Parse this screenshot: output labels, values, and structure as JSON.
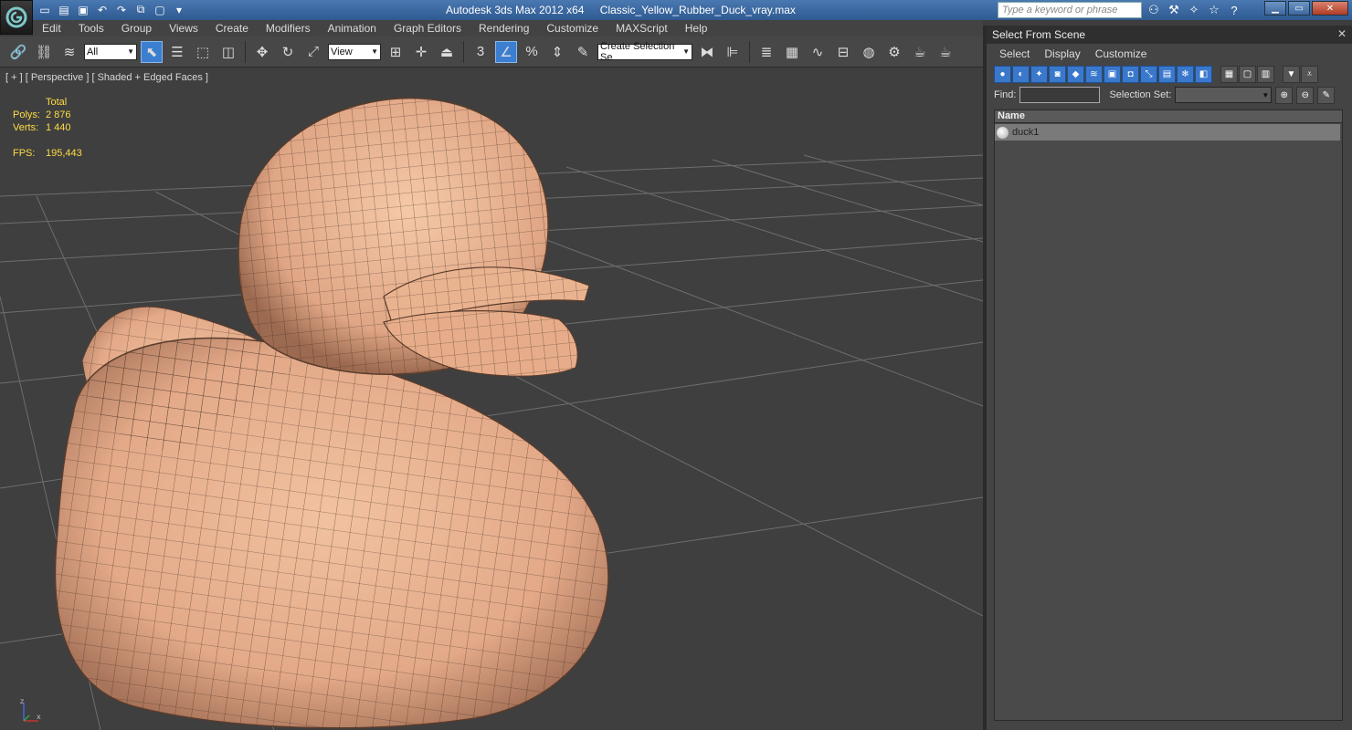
{
  "window": {
    "app_name": "Autodesk 3ds Max  2012 x64",
    "file_name": "Classic_Yellow_Rubber_Duck_vray.max",
    "search_placeholder": "Type a keyword or phrase"
  },
  "menu": [
    "Edit",
    "Tools",
    "Group",
    "Views",
    "Create",
    "Modifiers",
    "Animation",
    "Graph Editors",
    "Rendering",
    "Customize",
    "MAXScript",
    "Help"
  ],
  "toolbar": {
    "filter_value": "All",
    "coord_value": "View",
    "selection_set_value": "Create Selection Se",
    "snap_label": "3"
  },
  "viewport": {
    "label": "[ + ] [ Perspective ] [ Shaded + Edged Faces ]",
    "stats_header": "Total",
    "polys_label": "Polys:",
    "polys_value": "2 876",
    "verts_label": "Verts:",
    "verts_value": "1 440",
    "fps_label": "FPS:",
    "fps_value": "195,443",
    "axis_z": "z",
    "axis_x": "x"
  },
  "explorer": {
    "title": "Select From Scene",
    "menu": [
      "Select",
      "Display",
      "Customize"
    ],
    "find_label": "Find:",
    "selection_set_label": "Selection Set:",
    "column_name": "Name",
    "items": [
      {
        "name": "duck1"
      }
    ]
  }
}
